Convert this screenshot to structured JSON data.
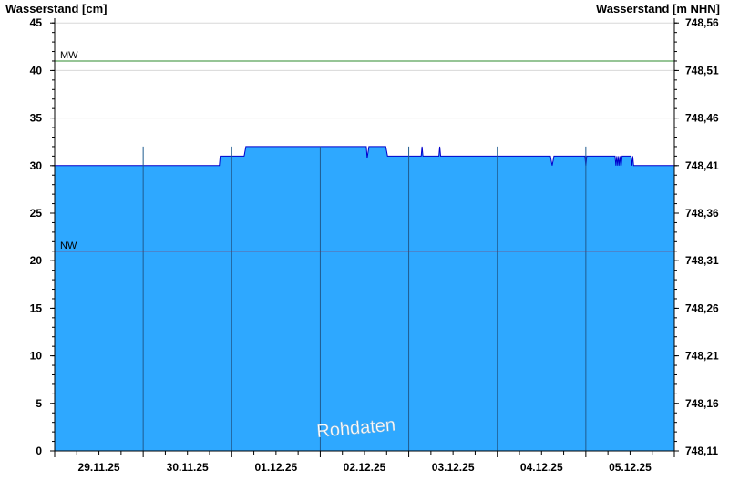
{
  "chart_data": {
    "type": "area",
    "ylabel_left": "Wasserstand [cm]",
    "ylabel_right": "Wasserstand [m NHN]",
    "ylim": [
      0,
      45.5
    ],
    "yticks_left": [
      0,
      5,
      10,
      15,
      20,
      25,
      30,
      35,
      40,
      45
    ],
    "yticks_right": [
      "748,11",
      "748,16",
      "748,21",
      "748,26",
      "748,31",
      "748,36",
      "748,41",
      "748,46",
      "748,51",
      "748,56"
    ],
    "x_range_days": [
      0,
      7
    ],
    "x_labels": [
      "29.11.25",
      "30.11.25",
      "01.12.25",
      "02.12.25",
      "03.12.25",
      "04.12.25",
      "05.12.25"
    ],
    "reference_lines": [
      {
        "label": "MW",
        "value": 41,
        "color": "#2e8b2e"
      },
      {
        "label": "NW",
        "value": 21,
        "color": "#a0203a"
      }
    ],
    "series": [
      {
        "fill": "#2ea8ff",
        "line": "#0000cc",
        "x": [
          0,
          1.86,
          1.87,
          2.14,
          2.16,
          3.52,
          3.53,
          3.55,
          3.56,
          3.74,
          3.76,
          4.14,
          4.15,
          4.16,
          4.34,
          4.35,
          4.36,
          4.37,
          5.6,
          5.62,
          5.64,
          5.99,
          6.0,
          6.01,
          6.33,
          6.34,
          6.35,
          6.36,
          6.37,
          6.38,
          6.39,
          6.4,
          6.41,
          6.42,
          6.43,
          6.5,
          6.51,
          6.52,
          6.53,
          6.54,
          6.55,
          6.56,
          7.0
        ],
        "y": [
          30,
          30,
          31,
          31,
          32,
          32,
          30.8,
          32,
          32,
          32,
          31,
          31,
          32,
          31,
          31,
          32,
          31,
          31,
          31,
          30,
          31,
          31,
          30,
          31,
          31,
          30,
          31,
          30,
          31,
          30,
          31,
          30,
          31,
          31,
          31,
          31,
          31,
          30,
          31,
          30,
          30,
          30,
          30
        ]
      }
    ],
    "annotation": "Rohdaten",
    "grid": true
  }
}
